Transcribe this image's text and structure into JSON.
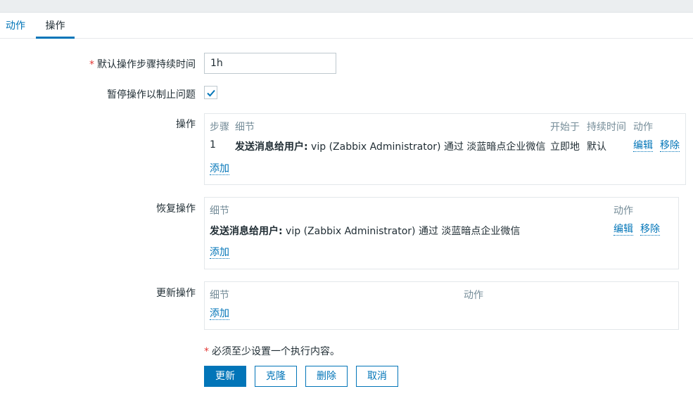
{
  "tabs": {
    "actions": "动作",
    "operations": "操作"
  },
  "form": {
    "default_duration_label": "默认操作步骤持续时间",
    "default_duration_value": "1h",
    "pause_label": "暂停操作以制止问题",
    "pause_checked": true,
    "required_marker": "*"
  },
  "operations": {
    "label": "操作",
    "headers": {
      "steps": "步骤",
      "details": "细节",
      "start_in": "开始于",
      "duration": "持续时间",
      "action": "动作"
    },
    "rows": [
      {
        "step": "1",
        "details_bold": "发送消息给用户:",
        "details_rest": " vip (Zabbix Administrator) 通过 淡蓝暗点企业微信",
        "start_in": "立即地",
        "duration": "默认",
        "edit": "编辑",
        "remove": "移除"
      }
    ],
    "add": "添加"
  },
  "recovery": {
    "label": "恢复操作",
    "headers": {
      "details": "细节",
      "action": "动作"
    },
    "rows": [
      {
        "details_bold": "发送消息给用户:",
        "details_rest": " vip (Zabbix Administrator) 通过 淡蓝暗点企业微信",
        "edit": "编辑",
        "remove": "移除"
      }
    ],
    "add": "添加"
  },
  "update": {
    "label": "更新操作",
    "headers": {
      "details": "细节",
      "action": "动作"
    },
    "add": "添加"
  },
  "note": "必须至少设置一个执行内容。",
  "buttons": {
    "update": "更新",
    "clone": "克隆",
    "delete": "删除",
    "cancel": "取消"
  }
}
